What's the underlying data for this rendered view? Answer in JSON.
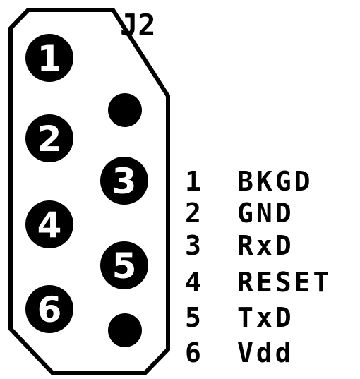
{
  "connector": {
    "designator": "J2",
    "pins": [
      {
        "number": "1"
      },
      {
        "number": "2"
      },
      {
        "number": "3"
      },
      {
        "number": "4"
      },
      {
        "number": "5"
      },
      {
        "number": "6"
      }
    ]
  },
  "legend": [
    {
      "number": "1",
      "signal": "BKGD"
    },
    {
      "number": "2",
      "signal": "GND"
    },
    {
      "number": "3",
      "signal": "RxD"
    },
    {
      "number": "4",
      "signal": "RESET"
    },
    {
      "number": "5",
      "signal": "TxD"
    },
    {
      "number": "6",
      "signal": "Vdd"
    }
  ],
  "colors": {
    "ink": "#000000",
    "background": "#ffffff",
    "pin_label": "#ffffff"
  }
}
